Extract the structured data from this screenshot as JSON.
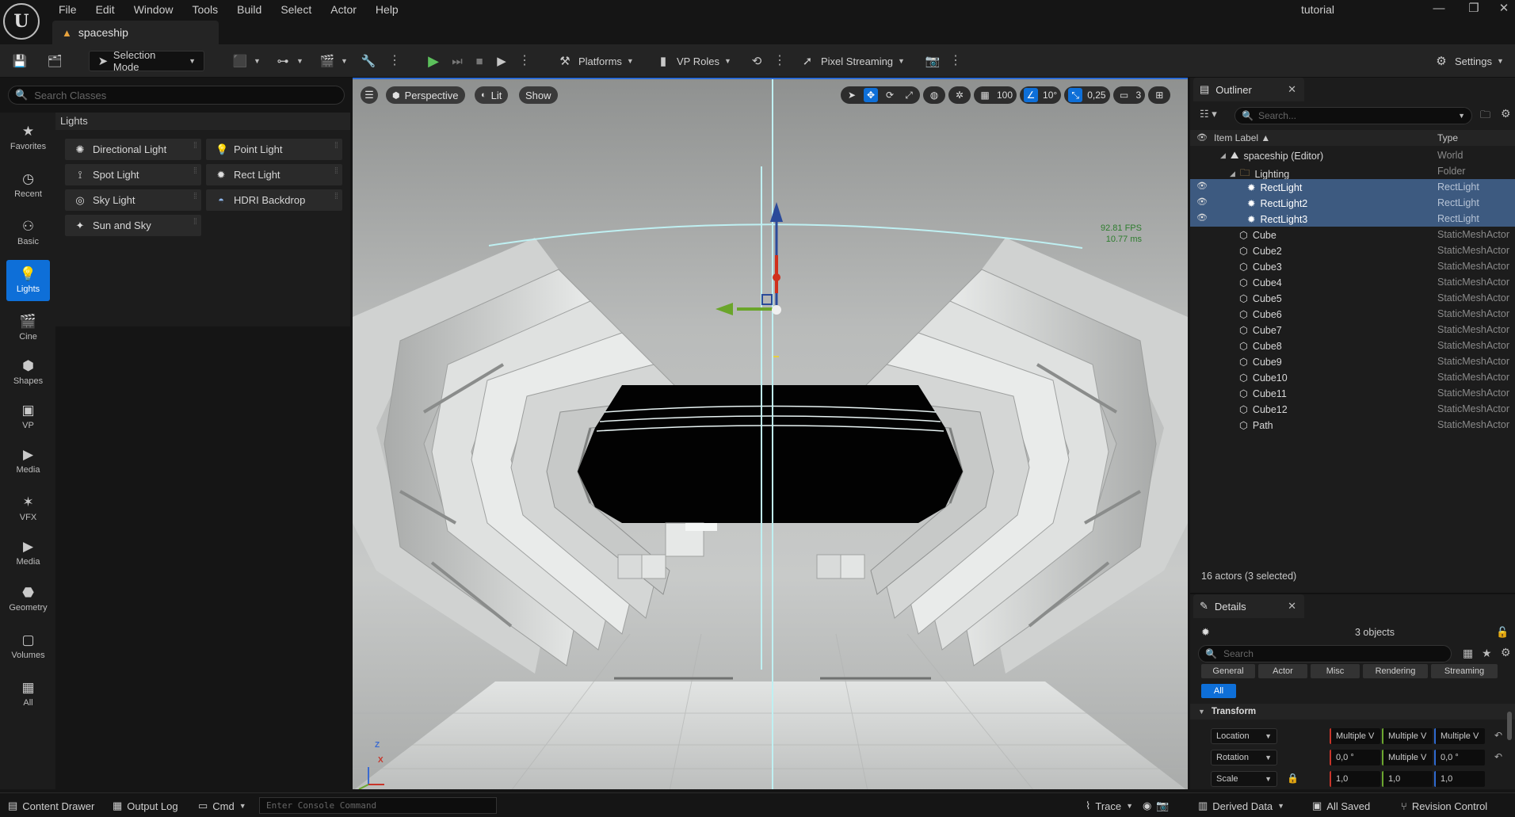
{
  "app": {
    "logo_text": "U",
    "project_name": "tutorial",
    "document_tab": "spaceship",
    "window_controls": [
      "—",
      "❐",
      "✕"
    ]
  },
  "menu": [
    "File",
    "Edit",
    "Window",
    "Tools",
    "Build",
    "Select",
    "Actor",
    "Help"
  ],
  "toolbar": {
    "selection_mode": "Selection Mode",
    "platforms": "Platforms",
    "vp_roles": "VP Roles",
    "pixel_streaming": "Pixel Streaming",
    "settings": "Settings"
  },
  "place_actors": {
    "search_placeholder": "Search Classes",
    "categories": [
      "Favorites",
      "Recent",
      "Basic",
      "Lights",
      "Cine",
      "Shapes",
      "VP",
      "Media",
      "VFX",
      "Media",
      "Geometry",
      "Volumes",
      "All"
    ],
    "category_icons": [
      "star-icon",
      "clock-icon",
      "basic-icon",
      "bulb-icon",
      "cine-icon",
      "shapes-icon",
      "vp-icon",
      "media-icon",
      "vfx-icon",
      "media-icon",
      "geometry-icon",
      "volumes-icon",
      "all-icon"
    ],
    "active_category": "Lights",
    "section_header": "Lights",
    "items": [
      "Directional Light",
      "Point Light",
      "Spot Light",
      "Rect Light",
      "Sky Light",
      "HDRI Backdrop",
      "Sun and Sky"
    ]
  },
  "viewport": {
    "perspective": "Perspective",
    "lit": "Lit",
    "show": "Show",
    "grid_snap": "100",
    "rotation_snap": "10°",
    "scale_snap": "0,25",
    "camera_speed": "3",
    "fps": "92.81 FPS",
    "frame_time": "10.77 ms",
    "gizmo_axes": [
      "Z",
      "X"
    ]
  },
  "outliner": {
    "tab_title": "Outliner",
    "search_placeholder": "Search...",
    "col_label": "Item Label ▲",
    "col_type": "Type",
    "rows": [
      {
        "label": "spaceship (Editor)",
        "type": "World"
      },
      {
        "label": "Lighting",
        "type": "Folder"
      },
      {
        "label": "RectLight",
        "type": "RectLight"
      },
      {
        "label": "RectLight2",
        "type": "RectLight"
      },
      {
        "label": "RectLight3",
        "type": "RectLight"
      },
      {
        "label": "Cube",
        "type": "StaticMeshActor"
      },
      {
        "label": "Cube2",
        "type": "StaticMeshActor"
      },
      {
        "label": "Cube3",
        "type": "StaticMeshActor"
      },
      {
        "label": "Cube4",
        "type": "StaticMeshActor"
      },
      {
        "label": "Cube5",
        "type": "StaticMeshActor"
      },
      {
        "label": "Cube6",
        "type": "StaticMeshActor"
      },
      {
        "label": "Cube7",
        "type": "StaticMeshActor"
      },
      {
        "label": "Cube8",
        "type": "StaticMeshActor"
      },
      {
        "label": "Cube9",
        "type": "StaticMeshActor"
      },
      {
        "label": "Cube10",
        "type": "StaticMeshActor"
      },
      {
        "label": "Cube11",
        "type": "StaticMeshActor"
      },
      {
        "label": "Cube12",
        "type": "StaticMeshActor"
      },
      {
        "label": "Path",
        "type": "StaticMeshActor"
      }
    ],
    "actor_count": "16 actors (3 selected)"
  },
  "details": {
    "tab_title": "Details",
    "objects": "3 objects",
    "search_placeholder": "Search",
    "filters": [
      "General",
      "Actor",
      "Misc",
      "Rendering",
      "Streaming",
      "All"
    ],
    "section": "Transform",
    "transform": [
      {
        "label": "Location",
        "values": [
          "Multiple V",
          "Multiple V",
          "Multiple V"
        ]
      },
      {
        "label": "Rotation",
        "values": [
          "0,0 °",
          "Multiple V",
          "0,0 °"
        ]
      },
      {
        "label": "Scale",
        "values": [
          "1,0",
          "1,0",
          "1,0"
        ]
      }
    ]
  },
  "statusbar": {
    "content_drawer": "Content Drawer",
    "output_log": "Output Log",
    "cmd": "Cmd",
    "console_placeholder": "Enter Console Command",
    "trace": "Trace",
    "derived_data": "Derived Data",
    "all_saved": "All Saved",
    "revision_control": "Revision Control"
  }
}
